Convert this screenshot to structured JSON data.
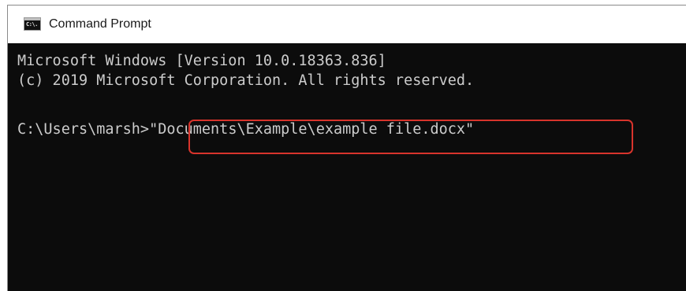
{
  "window": {
    "title": "Command Prompt",
    "icon": "cmd-icon",
    "icon_text": "C:\\."
  },
  "console": {
    "lines": [
      "Microsoft Windows [Version 10.0.18363.836]",
      "(c) 2019 Microsoft Corporation. All rights reserved.",
      ""
    ],
    "prompt": "C:\\Users\\marsh>",
    "command": "\"Documents\\Example\\example file.docx\""
  },
  "annotation": {
    "highlight_color": "#d8342c"
  },
  "colors": {
    "console_background": "#0c0c0c",
    "console_text": "#cccccc",
    "titlebar_background": "#ffffff"
  }
}
